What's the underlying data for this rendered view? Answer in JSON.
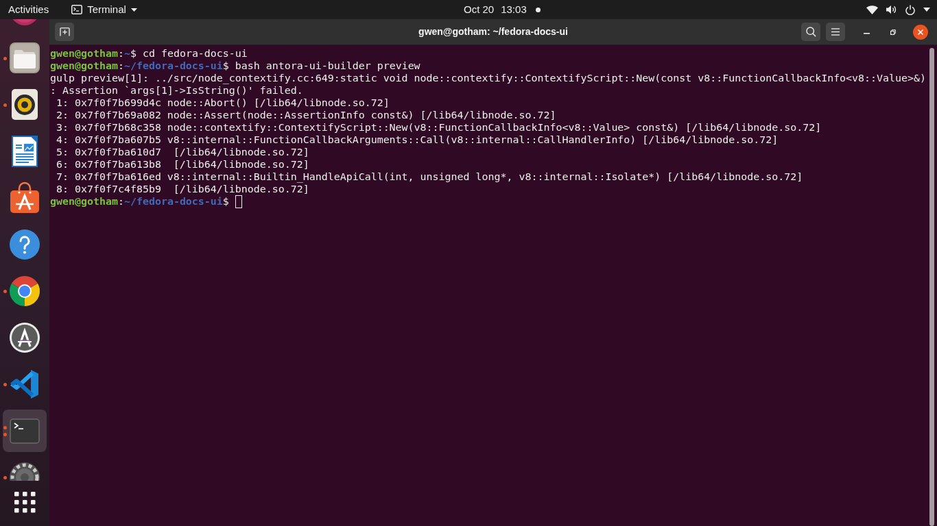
{
  "top_bar": {
    "activities": "Activities",
    "app_menu": {
      "label": "Terminal"
    },
    "clock": {
      "date": "Oct 20",
      "time": "13:03"
    },
    "notification_dot": true
  },
  "dock": {
    "items": [
      {
        "kind": "disc",
        "running": false,
        "multiple_windows": false,
        "selected": false
      },
      {
        "kind": "folder",
        "running": true,
        "multiple_windows": false,
        "selected": false
      },
      {
        "kind": "speaker",
        "running": true,
        "multiple_windows": false,
        "selected": false
      },
      {
        "kind": "document",
        "running": false,
        "multiple_windows": false,
        "selected": false
      },
      {
        "kind": "bag",
        "running": false,
        "multiple_windows": false,
        "selected": false
      },
      {
        "kind": "help",
        "running": false,
        "multiple_windows": false,
        "selected": false
      },
      {
        "kind": "browser",
        "running": true,
        "multiple_windows": false,
        "selected": false
      },
      {
        "kind": "updater",
        "running": false,
        "multiple_windows": false,
        "selected": false
      },
      {
        "kind": "code",
        "running": true,
        "multiple_windows": false,
        "selected": false
      },
      {
        "kind": "terminal",
        "running": true,
        "multiple_windows": true,
        "selected": true
      },
      {
        "kind": "gear",
        "running": true,
        "multiple_windows": false,
        "selected": false
      }
    ]
  },
  "window": {
    "title": "gwen@gotham: ~/fedora-docs-ui"
  },
  "terminal": {
    "lines": [
      {
        "kind": "prompt",
        "user": "gwen@gotham",
        "separator": ":",
        "path": "~",
        "symbol": "$",
        "command": "cd fedora-docs-ui",
        "cursor": false
      },
      {
        "kind": "prompt",
        "user": "gwen@gotham",
        "separator": ":",
        "path": "~/fedora-docs-ui",
        "symbol": "$",
        "command": "bash antora-ui-builder preview",
        "cursor": false
      },
      {
        "kind": "output",
        "text": "gulp preview[1]: ../src/node_contextify.cc:649:static void node::contextify::ContextifyScript::New(const v8::FunctionCallbackInfo<v8::Value>&)"
      },
      {
        "kind": "output",
        "text": ": Assertion `args[1]->IsString()' failed."
      },
      {
        "kind": "output",
        "text": " 1: 0x7f0f7b699d4c node::Abort() [/lib64/libnode.so.72]"
      },
      {
        "kind": "output",
        "text": " 2: 0x7f0f7b69a082 node::Assert(node::AssertionInfo const&) [/lib64/libnode.so.72]"
      },
      {
        "kind": "output",
        "text": " 3: 0x7f0f7b68c358 node::contextify::ContextifyScript::New(v8::FunctionCallbackInfo<v8::Value> const&) [/lib64/libnode.so.72]"
      },
      {
        "kind": "output",
        "text": " 4: 0x7f0f7ba607b5 v8::internal::FunctionCallbackArguments::Call(v8::internal::CallHandlerInfo) [/lib64/libnode.so.72]"
      },
      {
        "kind": "output",
        "text": " 5: 0x7f0f7ba610d7  [/lib64/libnode.so.72]"
      },
      {
        "kind": "output",
        "text": " 6: 0x7f0f7ba613b8  [/lib64/libnode.so.72]"
      },
      {
        "kind": "output",
        "text": " 7: 0x7f0f7ba616ed v8::internal::Builtin_HandleApiCall(int, unsigned long*, v8::internal::Isolate*) [/lib64/libnode.so.72]"
      },
      {
        "kind": "output",
        "text": " 8: 0x7f0f7c4f85b9  [/lib64/libnode.so.72]"
      },
      {
        "kind": "prompt",
        "user": "gwen@gotham",
        "separator": ":",
        "path": "~/fedora-docs-ui",
        "symbol": "$",
        "cursor": true
      }
    ]
  }
}
